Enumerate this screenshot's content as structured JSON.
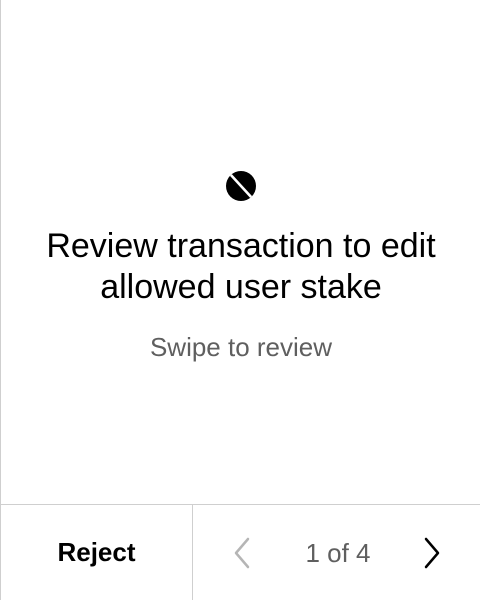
{
  "review": {
    "app_icon": "ontology-logo-icon",
    "title": "Review transaction to edit allowed user stake",
    "subtitle": "Swipe to review"
  },
  "footer": {
    "reject_label": "Reject",
    "prev_icon": "chevron-left-icon",
    "next_icon": "chevron-right-icon",
    "page_indicator": "1 of 4"
  },
  "colors": {
    "background": "#ffffff",
    "text_primary": "#000000",
    "text_secondary": "#5f5f5f",
    "divider": "#cfcfcf",
    "nav_disabled": "#b5b5b5"
  }
}
